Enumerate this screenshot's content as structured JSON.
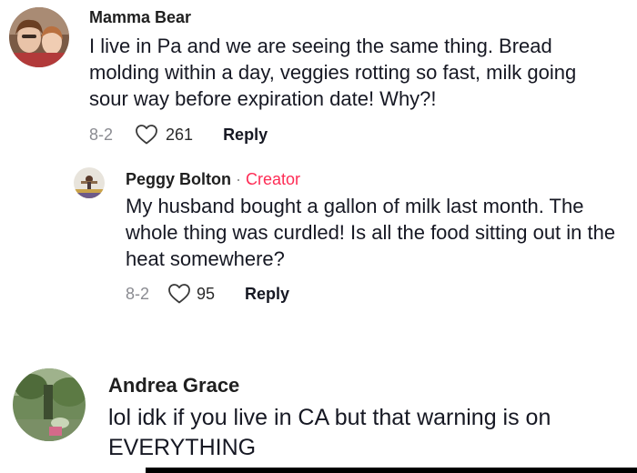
{
  "comments": [
    {
      "username": "Mamma Bear",
      "text": "I live in Pa and we are seeing the same thing. Bread molding within a day, veggies rotting so fast, milk going sour way before expiration date! Why?!",
      "date": "8-2",
      "likes": "261",
      "reply_label": "Reply"
    },
    {
      "username": "Peggy Bolton",
      "separator": "·",
      "creator_label": "Creator",
      "text": "My husband bought a gallon of milk last month. The whole thing was curdled! Is all the food sitting out in the heat somewhere?",
      "date": "8-2",
      "likes": "95",
      "reply_label": "Reply"
    },
    {
      "username": "Andrea Grace",
      "text": "lol idk if you live in CA but that warning is on EVERYTHING"
    }
  ],
  "icons": {
    "like": "heart-outline-icon"
  },
  "colors": {
    "creator": "#fe2c55",
    "meta_gray": "#8a8b91",
    "text": "#161823"
  }
}
